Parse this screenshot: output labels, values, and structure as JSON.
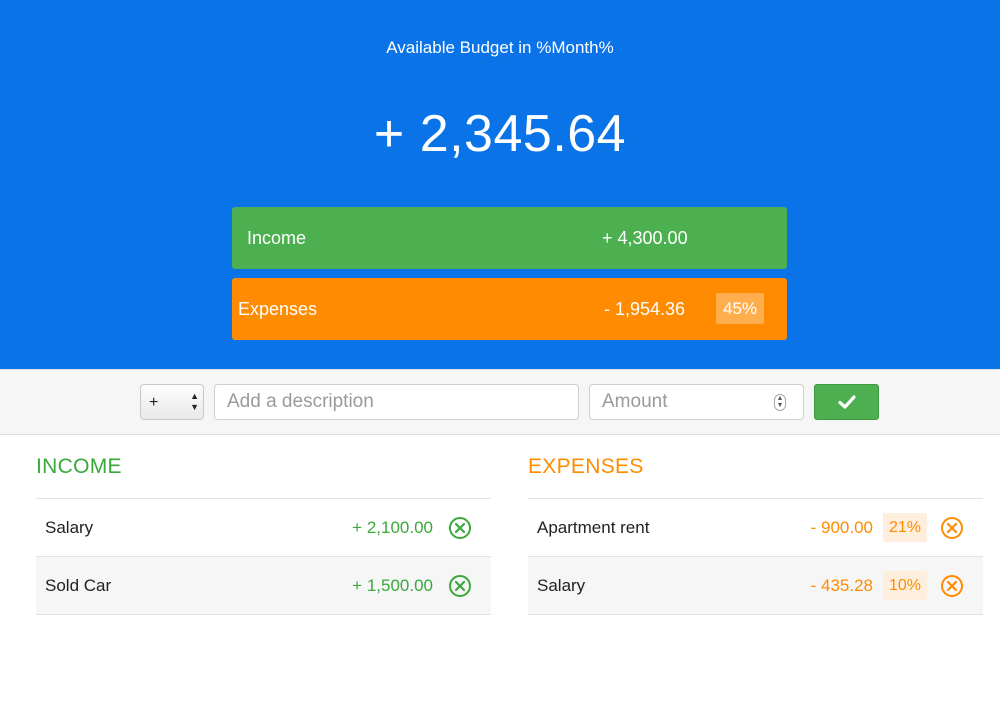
{
  "header": {
    "title": "Available Budget in %Month%",
    "budget": "+ 2,345.64"
  },
  "summary": {
    "income": {
      "label": "Income",
      "value": "+ 4,300.00"
    },
    "expenses": {
      "label": "Expenses",
      "value": "- 1,954.36",
      "percentage": "45%"
    }
  },
  "add_form": {
    "type_value": "+",
    "description_placeholder": "Add a description",
    "amount_placeholder": "Amount",
    "submit_icon": "checkmark-icon"
  },
  "income": {
    "title": "INCOME",
    "items": [
      {
        "description": "Salary",
        "value": "+ 2,100.00"
      },
      {
        "description": "Sold Car",
        "value": "+ 1,500.00"
      }
    ]
  },
  "expenses": {
    "title": "EXPENSES",
    "items": [
      {
        "description": "Apartment rent",
        "value": "- 900.00",
        "percentage": "21%"
      },
      {
        "description": "Salary",
        "value": "- 435.28",
        "percentage": "10%"
      }
    ]
  },
  "colors": {
    "header_bg": "#0b73e8",
    "income": "#4caf50",
    "expenses": "#ff8c00"
  }
}
